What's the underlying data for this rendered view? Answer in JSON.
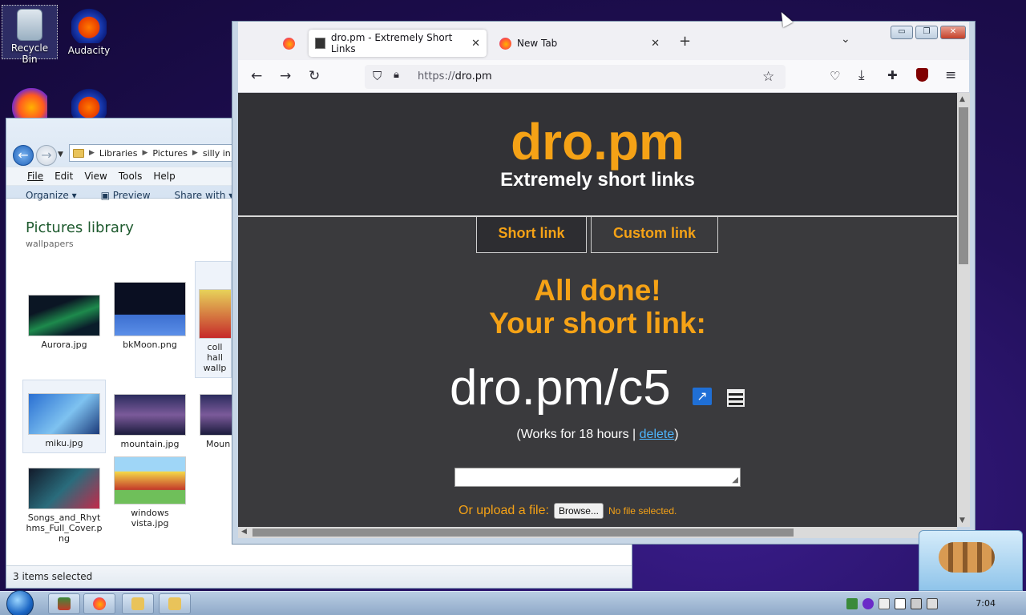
{
  "desktop": {
    "icons": [
      {
        "label": "Recycle Bin"
      },
      {
        "label": "Audacity"
      }
    ]
  },
  "explorer": {
    "breadcrumb": [
      "Libraries",
      "Pictures",
      "silly in"
    ],
    "menu": [
      "File",
      "Edit",
      "View",
      "Tools",
      "Help"
    ],
    "toolbar": {
      "organize": "Organize",
      "preview": "Preview",
      "share": "Share with"
    },
    "library_title": "Pictures library",
    "library_sub": "wallpapers",
    "files": [
      {
        "name": "Aurora.jpg"
      },
      {
        "name": "bkMoon.png"
      },
      {
        "name": "coll hall wallp"
      },
      {
        "name": "miku.jpg"
      },
      {
        "name": "mountain.jpg"
      },
      {
        "name": "Moun"
      },
      {
        "name": "Songs_and_Rhythms_Full_Cover.png"
      },
      {
        "name": "windows vista.jpg"
      }
    ],
    "status": "3 items selected"
  },
  "browser": {
    "tabs": [
      {
        "title": "dro.pm - Extremely Short Links",
        "active": true
      },
      {
        "title": "New Tab",
        "active": false
      }
    ],
    "url_prefix": "https://",
    "url_host": "dro.pm",
    "page": {
      "brand": "dro.pm",
      "tagline": "Extremely short links",
      "tab_short": "Short link",
      "tab_custom": "Custom link",
      "done_line1": "All done!",
      "done_line2": "Your short link:",
      "short_link": "dro.pm/c5",
      "works_prefix": "(Works for 18 hours | ",
      "delete_label": "delete",
      "works_suffix": ")",
      "upload_label": "Or upload a file:",
      "browse_label": "Browse...",
      "no_file": "No file selected."
    }
  },
  "taskbar": {
    "clock": "7:04"
  },
  "colors": {
    "accent": "#f5a216",
    "page_bg": "#3a3a3d",
    "link": "#4db6ff"
  }
}
